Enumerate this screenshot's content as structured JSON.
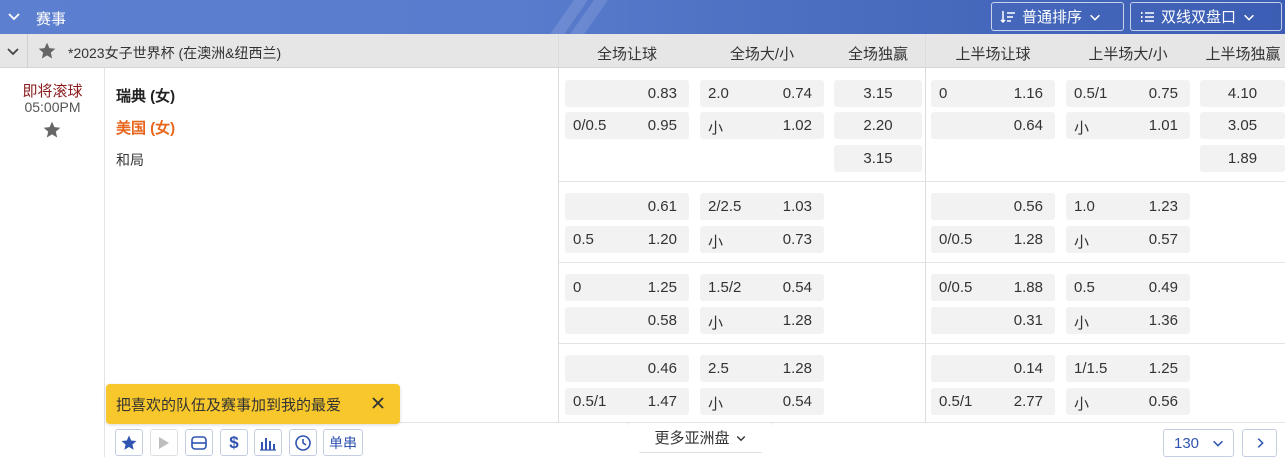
{
  "header": {
    "title": "赛事",
    "sort_label": "普通排序",
    "view_label": "双线双盘口"
  },
  "league": {
    "name": "*2023女子世界杯 (在澳洲&纽西兰)"
  },
  "columns": [
    "全场让球",
    "全场大/小",
    "全场独赢",
    "上半场让球",
    "上半场大/小",
    "上半场独赢"
  ],
  "match": {
    "status": "即将滚球",
    "time": "05:00PM",
    "home": "瑞典 (女)",
    "away": "美国 (女)",
    "draw": "和局"
  },
  "odds": {
    "main": {
      "ft_hdp": [
        {
          "line": "",
          "odds": "0.83"
        },
        {
          "line": "0/0.5",
          "odds": "0.95"
        }
      ],
      "ft_ou": [
        {
          "line": "2.0",
          "odds": "0.74"
        },
        {
          "line": "小",
          "odds": "1.02"
        }
      ],
      "ft_1x2": [
        "3.15",
        "2.20",
        "3.15"
      ],
      "ht_hdp": [
        {
          "line": "0",
          "odds": "1.16"
        },
        {
          "line": "",
          "odds": "0.64"
        }
      ],
      "ht_ou": [
        {
          "line": "0.5/1",
          "odds": "0.75"
        },
        {
          "line": "小",
          "odds": "1.01"
        }
      ],
      "ht_1x2": [
        "4.10",
        "3.05",
        "1.89"
      ]
    },
    "alt1": {
      "ft_hdp": [
        {
          "line": "",
          "odds": "0.61"
        },
        {
          "line": "0.5",
          "odds": "1.20"
        }
      ],
      "ft_ou": [
        {
          "line": "2/2.5",
          "odds": "1.03"
        },
        {
          "line": "小",
          "odds": "0.73"
        }
      ],
      "ht_hdp": [
        {
          "line": "",
          "odds": "0.56"
        },
        {
          "line": "0/0.5",
          "odds": "1.28"
        }
      ],
      "ht_ou": [
        {
          "line": "1.0",
          "odds": "1.23"
        },
        {
          "line": "小",
          "odds": "0.57"
        }
      ]
    },
    "alt2": {
      "ft_hdp": [
        {
          "line": "0",
          "odds": "1.25"
        },
        {
          "line": "",
          "odds": "0.58"
        }
      ],
      "ft_ou": [
        {
          "line": "1.5/2",
          "odds": "0.54"
        },
        {
          "line": "小",
          "odds": "1.28"
        }
      ],
      "ht_hdp": [
        {
          "line": "0/0.5",
          "odds": "1.88"
        },
        {
          "line": "",
          "odds": "0.31"
        }
      ],
      "ht_ou": [
        {
          "line": "0.5",
          "odds": "0.49"
        },
        {
          "line": "小",
          "odds": "1.36"
        }
      ]
    },
    "alt3": {
      "ft_hdp": [
        {
          "line": "",
          "odds": "0.46"
        },
        {
          "line": "0.5/1",
          "odds": "1.47"
        }
      ],
      "ft_ou": [
        {
          "line": "2.5",
          "odds": "1.28"
        },
        {
          "line": "小",
          "odds": "0.54"
        }
      ],
      "ht_hdp": [
        {
          "line": "",
          "odds": "0.14"
        },
        {
          "line": "0.5/1",
          "odds": "2.77"
        }
      ],
      "ht_ou": [
        {
          "line": "1/1.5",
          "odds": "1.25"
        },
        {
          "line": "小",
          "odds": "0.56"
        }
      ]
    }
  },
  "tooltip": {
    "text": "把喜欢的队伍及赛事加到我的最爱"
  },
  "footer": {
    "single_label": "单串",
    "more_label": "更多亚洲盘",
    "page_size": "130"
  },
  "colors": {
    "header_blue": "#4e70c2",
    "accent_blue": "#2f55b0",
    "away_orange": "#e8661c",
    "tooltip_yellow": "#f7c72b"
  }
}
